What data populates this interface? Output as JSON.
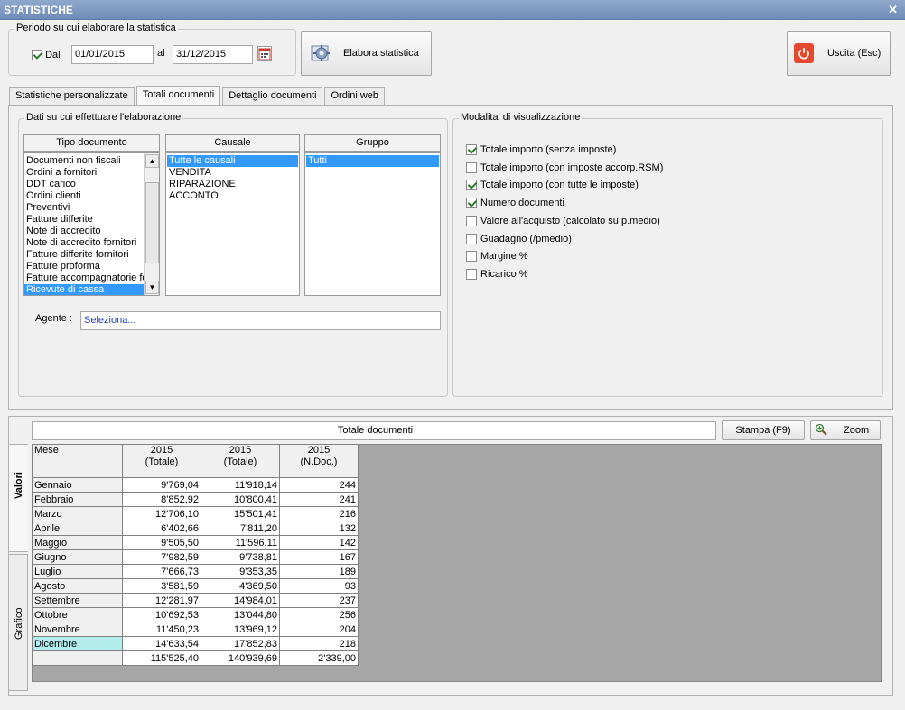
{
  "window": {
    "title": "STATISTICHE",
    "close_glyph": "✕"
  },
  "period": {
    "legend": "Periodo su cui elaborare la statistica",
    "dal_label": "Dal",
    "dal_checked": true,
    "from": "01/01/2015",
    "al_label": "al",
    "to": "31/12/2015"
  },
  "buttons": {
    "elabora": "Elabora statistica",
    "uscita": "Uscita (Esc)",
    "stampa": "Stampa (F9)",
    "zoom": "Zoom"
  },
  "tabs": [
    {
      "label": "Statistiche personalizzate",
      "active": false
    },
    {
      "label": "Totali documenti",
      "active": true
    },
    {
      "label": "Dettaglio documenti",
      "active": false
    },
    {
      "label": "Ordini web",
      "active": false
    }
  ],
  "data_section": {
    "legend": "Dati su cui effettuare l'elaborazione",
    "tipo_header": "Tipo documento",
    "causale_header": "Causale",
    "gruppo_header": "Gruppo",
    "tipo_items": [
      "Documenti non fiscali",
      "Ordini a fornitori",
      "DDT carico",
      "Ordini clienti",
      "Preventivi",
      "Fatture differite",
      "Note di accredito",
      "Note di accredito fornitori",
      "Fatture differite fornitori",
      "Fatture proforma",
      "Fatture accompagnatorie fo",
      "Ricevute di cassa"
    ],
    "tipo_selected": "Ricevute di cassa",
    "causale_items": [
      "Tutte le causali",
      "VENDITA",
      "RIPARAZIONE",
      "ACCONTO"
    ],
    "causale_selected": "Tutte le causali",
    "gruppo_items": [
      "Tutti"
    ],
    "gruppo_selected": "Tutti",
    "agente_label": "Agente :",
    "agente_value": "Seleziona..."
  },
  "modes": {
    "legend": "Modalita' di visualizzazione",
    "items": [
      {
        "label": "Totale importo (senza imposte)",
        "checked": true
      },
      {
        "label": "Totale importo (con imposte accorp.RSM)",
        "checked": false
      },
      {
        "label": "Totale importo (con tutte le imposte)",
        "checked": true
      },
      {
        "label": "Numero documenti",
        "checked": true
      },
      {
        "label": "Valore all'acquisto (calcolato su p.medio)",
        "checked": false
      },
      {
        "label": "Guadagno (/pmedio)",
        "checked": false
      },
      {
        "label": "Margine %",
        "checked": false
      },
      {
        "label": "Ricarico %",
        "checked": false
      }
    ]
  },
  "results": {
    "title": "Totale documenti",
    "side_tabs": [
      "Valori",
      "Grafico"
    ],
    "columns": [
      "Mese",
      "2015\n(Totale)",
      "2015\n(Totale)",
      "2015\n(N.Doc.)"
    ],
    "rows": [
      [
        "Gennaio",
        "9'769,04",
        "11'918,14",
        "244"
      ],
      [
        "Febbraio",
        "8'852,92",
        "10'800,41",
        "241"
      ],
      [
        "Marzo",
        "12'706,10",
        "15'501,41",
        "216"
      ],
      [
        "Aprile",
        "6'402,66",
        "7'811,20",
        "132"
      ],
      [
        "Maggio",
        "9'505,50",
        "11'596,11",
        "142"
      ],
      [
        "Giugno",
        "7'982,59",
        "9'738,81",
        "167"
      ],
      [
        "Luglio",
        "7'666,73",
        "9'353,35",
        "189"
      ],
      [
        "Agosto",
        "3'581,59",
        "4'369,50",
        "93"
      ],
      [
        "Settembre",
        "12'281,97",
        "14'984,01",
        "237"
      ],
      [
        "Ottobre",
        "10'692,53",
        "13'044,80",
        "256"
      ],
      [
        "Novembre",
        "11'450,23",
        "13'969,12",
        "204"
      ],
      [
        "Dicembre",
        "14'633,54",
        "17'852,83",
        "218"
      ]
    ],
    "highlight_row": "Dicembre",
    "totals": [
      "",
      "115'525,40",
      "140'939,69",
      "2'339,00"
    ]
  }
}
